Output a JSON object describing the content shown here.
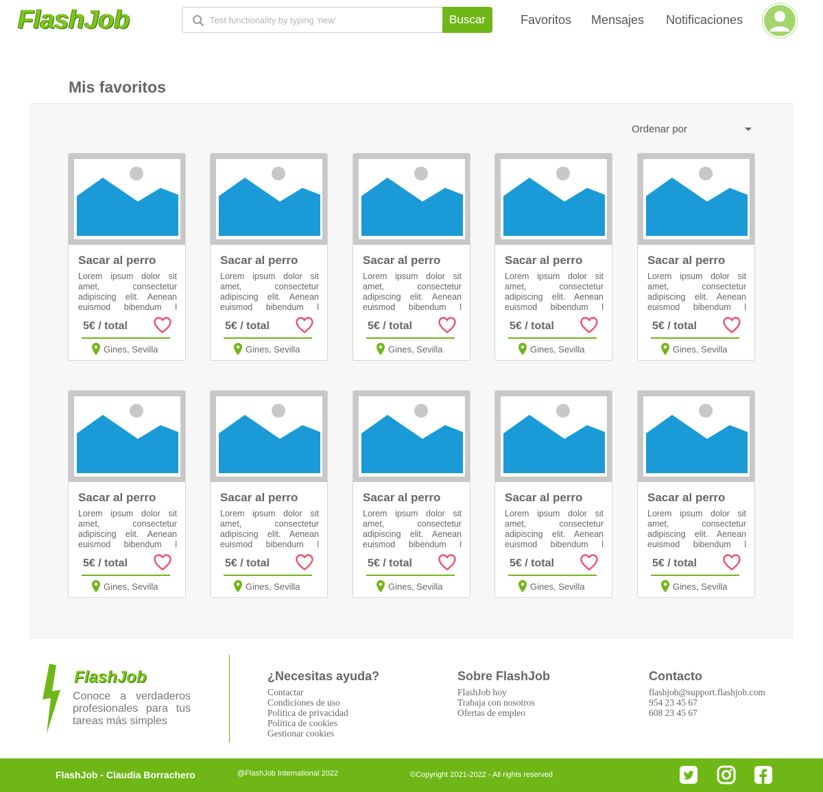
{
  "header": {
    "logo": "FlashJob",
    "search_placeholder": "Test functionality by typing 'new'",
    "search_button": "Buscar",
    "nav": [
      "Favoritos",
      "Mensajes",
      "Notificaciones"
    ]
  },
  "main": {
    "title": "Mis favoritos",
    "sort_label": "Ordenar por",
    "cards": [
      {
        "title": "Sacar al perro",
        "desc": "Lorem ipsum dolor sit amet, consectetur adipiscing elit. Aenean euismod bibendum l",
        "price": "5€ / total",
        "location": "Gines, Sevilla"
      },
      {
        "title": "Sacar al perro",
        "desc": "Lorem ipsum dolor sit amet, consectetur adipiscing elit. Aenean euismod bibendum l",
        "price": "5€ / total",
        "location": "Gines, Sevilla"
      },
      {
        "title": "Sacar al perro",
        "desc": "Lorem ipsum dolor sit amet, consectetur adipiscing elit. Aenean euismod bibendum l",
        "price": "5€ / total",
        "location": "Gines, Sevilla"
      },
      {
        "title": "Sacar al perro",
        "desc": "Lorem ipsum dolor sit amet, consectetur adipiscing elit. Aenean euismod bibendum l",
        "price": "5€ / total",
        "location": "Gines, Sevilla"
      },
      {
        "title": "Sacar al perro",
        "desc": "Lorem ipsum dolor sit amet, consectetur adipiscing elit. Aenean euismod bibendum l",
        "price": "5€ / total",
        "location": "Gines, Sevilla"
      },
      {
        "title": "Sacar al perro",
        "desc": "Lorem ipsum dolor sit amet, consectetur adipiscing elit. Aenean euismod bibendum l",
        "price": "5€ / total",
        "location": "Gines, Sevilla"
      },
      {
        "title": "Sacar al perro",
        "desc": "Lorem ipsum dolor sit amet, consectetur adipiscing elit. Aenean euismod bibendum l",
        "price": "5€ / total",
        "location": "Gines, Sevilla"
      },
      {
        "title": "Sacar al perro",
        "desc": "Lorem ipsum dolor sit amet, consectetur adipiscing elit. Aenean euismod bibendum l",
        "price": "5€ / total",
        "location": "Gines, Sevilla"
      },
      {
        "title": "Sacar al perro",
        "desc": "Lorem ipsum dolor sit amet, consectetur adipiscing elit. Aenean euismod bibendum l",
        "price": "5€ / total",
        "location": "Gines, Sevilla"
      },
      {
        "title": "Sacar al perro",
        "desc": "Lorem ipsum dolor sit amet, consectetur adipiscing elit. Aenean euismod bibendum l",
        "price": "5€ / total",
        "location": "Gines, Sevilla"
      }
    ]
  },
  "footer": {
    "logo": "FlashJob",
    "tagline": "Conoce a verdaderos profesionales para tus tareas más simples",
    "help": {
      "heading": "¿Necesitas ayuda?",
      "links": [
        "Contactar",
        "Condiciones de uso",
        "Política de privacidad",
        "Política de cookies",
        "Gestionar cookies"
      ]
    },
    "about": {
      "heading": "Sobre FlashJob",
      "links": [
        "FlashJob hoy",
        "Trabaja con nosotros",
        "Ofertas de empleo"
      ]
    },
    "contact": {
      "heading": "Contacto",
      "lines": [
        "flashjob@support.flashjob.com",
        "954 23 45 67",
        "608 23 45 67"
      ]
    },
    "bottom": {
      "author": "FlashJob - Claudia Borrachero",
      "handle": "@FlashJob International 2022",
      "copyright": "©Copyright  2021-2022 - All rights reserved"
    },
    "social_icons": [
      "twitter-icon",
      "instagram-icon",
      "facebook-icon"
    ]
  },
  "colors": {
    "brand_green": "#6fb717",
    "image_blue": "#1a9bd7",
    "heart_red": "#f0506e"
  }
}
